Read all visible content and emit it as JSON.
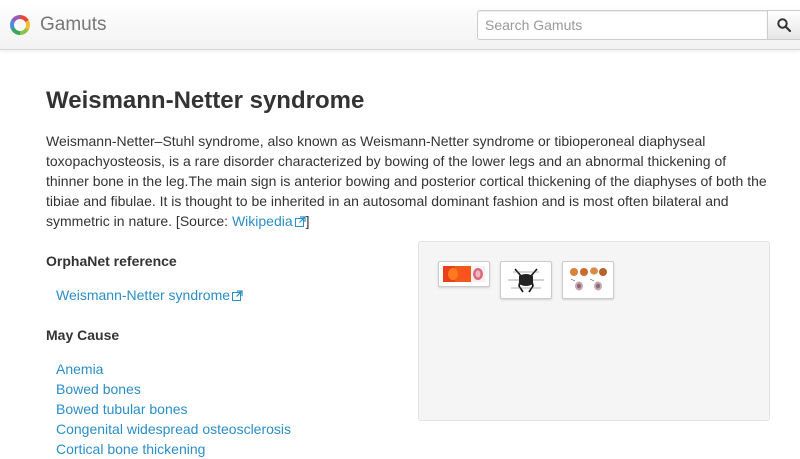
{
  "header": {
    "brand": "Gamuts",
    "search_placeholder": "Search Gamuts",
    "search_icon": "search-icon"
  },
  "page": {
    "title": "Weismann-Netter syndrome",
    "description": "Weismann-Netter–Stuhl syndrome, also known as Weismann-Netter syndrome or tibioperoneal diaphyseal toxopachyosteosis, is a rare disorder characterized by bowing of the lower legs and an abnormal thickening of thinner bone in the leg.The main sign is anterior bowing and posterior cortical thickening of the diaphyses of both the tibiae and fibulae. It is thought to be inherited in an autosomal dominant fashion and is most often bilateral and symmetric in nature. [Source: ",
    "source_link": "Wikipedia",
    "source_close": "]"
  },
  "orphanet": {
    "heading": "OrphaNet reference",
    "link": "Weismann-Netter syndrome"
  },
  "may_cause": {
    "heading": "May Cause",
    "items": [
      "Anemia",
      "Bowed bones",
      "Bowed tubular bones",
      "Congenital widespread osteosclerosis",
      "Cortical bone thickening"
    ]
  },
  "images": [
    {
      "name": "thumbnail-1",
      "icon": "image-thumbnail-icon"
    },
    {
      "name": "thumbnail-2",
      "icon": "image-thumbnail-icon"
    },
    {
      "name": "thumbnail-3",
      "icon": "image-thumbnail-icon"
    }
  ],
  "colors": {
    "link": "#2a8ec7",
    "text": "#333333",
    "brand_text": "#777777",
    "panel_bg": "#f5f5f5"
  }
}
